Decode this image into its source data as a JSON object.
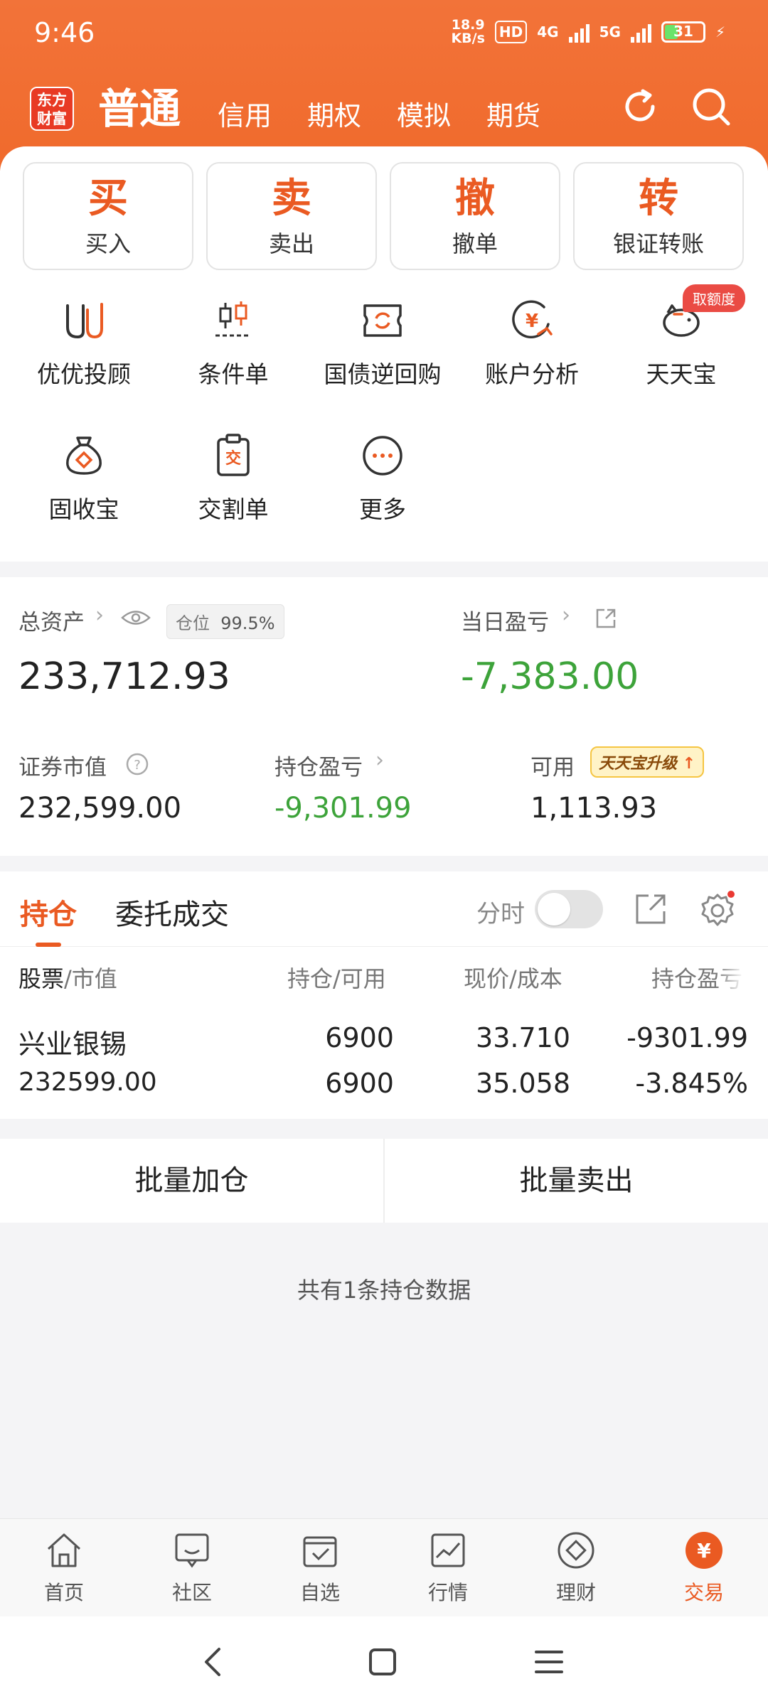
{
  "status_bar": {
    "time": "9:46",
    "net_speed_value": "18.9",
    "net_speed_unit": "KB/s",
    "hd": "HD",
    "net1": "4G",
    "net2": "5G",
    "battery": "31"
  },
  "header": {
    "logo_line1": "东方",
    "logo_line2": "财富",
    "tabs": [
      {
        "label": "普通"
      },
      {
        "label": "信用"
      },
      {
        "label": "期权"
      },
      {
        "label": "模拟"
      },
      {
        "label": "期货"
      }
    ]
  },
  "primary_actions": [
    {
      "char": "买",
      "label": "买入"
    },
    {
      "char": "卖",
      "label": "卖出"
    },
    {
      "char": "撤",
      "label": "撤单"
    },
    {
      "char": "转",
      "label": "银证转账"
    }
  ],
  "shortcuts": [
    {
      "label": "优优投顾",
      "icon": "uu-advisor-icon"
    },
    {
      "label": "条件单",
      "icon": "candlestick-icon"
    },
    {
      "label": "国债逆回购",
      "icon": "bond-repo-icon"
    },
    {
      "label": "账户分析",
      "icon": "yuan-chart-icon"
    },
    {
      "label": "天天宝",
      "icon": "piggy-bank-icon"
    },
    {
      "label": "固收宝",
      "icon": "money-bag-icon"
    },
    {
      "label": "交割单",
      "icon": "clipboard-icon"
    },
    {
      "label": "更多",
      "icon": "more-icon"
    }
  ],
  "shortcut_badge": "取额度",
  "clipboard_char": "交",
  "assets": {
    "total_label": "总资产",
    "position_label": "仓位",
    "position_value": "99.5%",
    "total_value": "233,712.93",
    "daily_pl_label": "当日盈亏",
    "daily_pl_value": "-7,383.00",
    "market_value_label": "证券市值",
    "market_value": "232,599.00",
    "holding_pl_label": "持仓盈亏",
    "holding_pl_value": "-9,301.99",
    "available_label": "可用",
    "available_value": "1,113.93",
    "upgrade_chip": "天天宝升级"
  },
  "holdings": {
    "tab_active": "持仓",
    "tab_other": "委托成交",
    "toggle_label": "分时",
    "headers": {
      "col1a": "股票",
      "col1b": "/市值",
      "col2": "持仓/可用",
      "col3": "现价/成本",
      "col4": "持仓盈亏"
    },
    "rows": [
      {
        "name": "兴业银锡",
        "market_value": "232599.00",
        "hold": "6900",
        "available": "6900",
        "price": "33.710",
        "cost": "35.058",
        "pl": "-9301.99",
        "pl_pct": "-3.845%"
      }
    ]
  },
  "actions": {
    "batch_add": "批量加仓",
    "batch_sell": "批量卖出"
  },
  "count_text": "共有1条持仓数据",
  "bottom_nav": [
    {
      "label": "首页",
      "icon": "home-icon"
    },
    {
      "label": "社区",
      "icon": "community-icon"
    },
    {
      "label": "自选",
      "icon": "watchlist-icon"
    },
    {
      "label": "行情",
      "icon": "market-icon"
    },
    {
      "label": "理财",
      "icon": "wealth-icon"
    },
    {
      "label": "交易",
      "icon": "trade-icon"
    }
  ],
  "trade_icon_char": "¥",
  "colors": {
    "brand": "#ea5a22",
    "header": "#f06a2c",
    "loss_green": "#3da33a"
  }
}
